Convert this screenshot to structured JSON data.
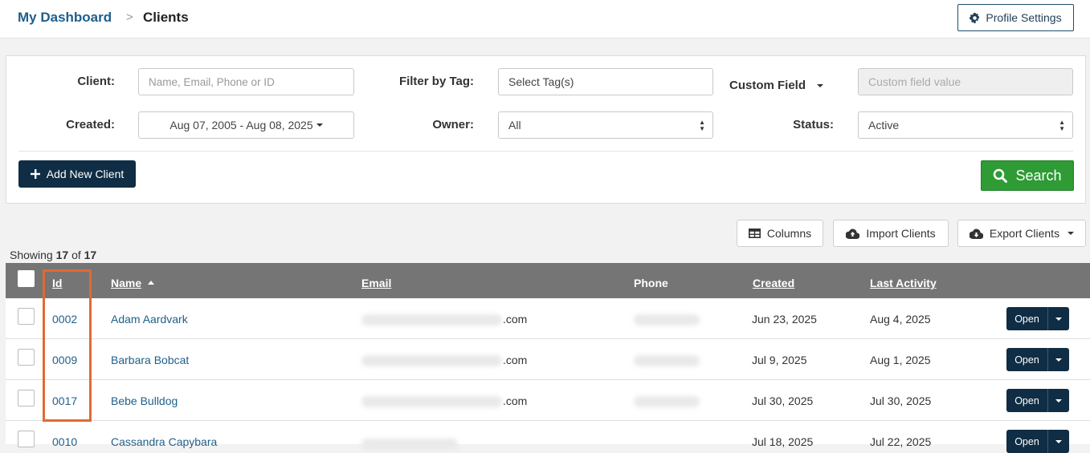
{
  "breadcrumb": {
    "home": "My Dashboard",
    "separator": ">",
    "current": "Clients"
  },
  "profile_button": {
    "label": "Profile Settings",
    "icon": "gear-icon"
  },
  "filters": {
    "client": {
      "label": "Client:",
      "placeholder": "Name, Email, Phone or ID"
    },
    "tag": {
      "label": "Filter by Tag:",
      "placeholder": "Select Tag(s)"
    },
    "custom_field": {
      "label": "Custom Field",
      "placeholder": "Custom field value"
    },
    "created": {
      "label": "Created:",
      "value": "Aug 07, 2005 - Aug 08, 2025"
    },
    "owner": {
      "label": "Owner:",
      "value": "All"
    },
    "status": {
      "label": "Status:",
      "value": "Active"
    }
  },
  "add_button": {
    "label": "Add New Client",
    "icon": "plus-icon"
  },
  "search_button": {
    "label": "Search",
    "icon": "search-icon"
  },
  "toolbar": {
    "columns": "Columns",
    "import": "Import Clients",
    "export": "Export Clients"
  },
  "showing": {
    "prefix": "Showing",
    "count": "17",
    "of": "of",
    "total": "17"
  },
  "table": {
    "headers": {
      "id": "Id",
      "name": "Name",
      "email": "Email",
      "phone": "Phone",
      "created": "Created",
      "last_activity": "Last Activity"
    },
    "rows": [
      {
        "id": "0002",
        "name": "Adam Aardvark",
        "email_suffix": ".com",
        "created": "Jun 23, 2025",
        "last_activity": "Aug 4, 2025",
        "action": "Open"
      },
      {
        "id": "0009",
        "name": "Barbara Bobcat",
        "email_suffix": ".com",
        "created": "Jul 9, 2025",
        "last_activity": "Aug 1, 2025",
        "action": "Open"
      },
      {
        "id": "0017",
        "name": "Bebe Bulldog",
        "email_suffix": ".com",
        "created": "Jul 30, 2025",
        "last_activity": "Jul 30, 2025",
        "action": "Open"
      },
      {
        "id": "0010",
        "name": "Cassandra Capybara",
        "email_suffix": "",
        "created": "Jul 18, 2025",
        "last_activity": "Jul 22, 2025",
        "action": "Open"
      }
    ]
  },
  "colors": {
    "brand_dark": "#0f2d44",
    "link": "#1f5f8b",
    "search_green": "#2e9b34",
    "highlight": "#e06a32",
    "header_gray": "#757575"
  }
}
